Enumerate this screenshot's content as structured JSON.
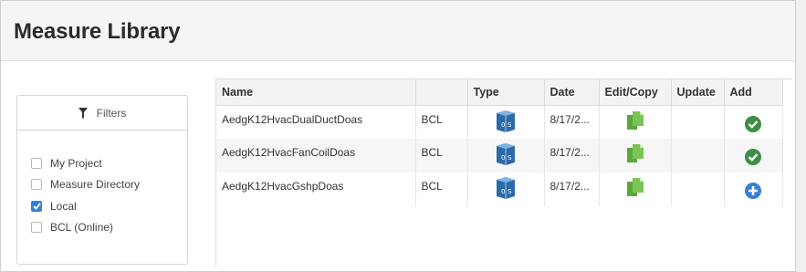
{
  "header": {
    "title": "Measure Library"
  },
  "filters": {
    "title": "Filters",
    "items": [
      {
        "label": "My Project",
        "checked": false
      },
      {
        "label": "Measure Directory",
        "checked": false
      },
      {
        "label": "Local",
        "checked": true
      },
      {
        "label": "BCL (Online)",
        "checked": false
      }
    ]
  },
  "table": {
    "columns": [
      "Name",
      "",
      "Type",
      "Date",
      "Edit/Copy",
      "Update",
      "Add"
    ],
    "rows": [
      {
        "name": "AedgK12HvacDualDuctDoas",
        "source": "BCL",
        "type_icon": "openstudio-icon",
        "date": "8/17/2...",
        "edit_icon": "copy-icon",
        "add_icon": "checkmark-icon",
        "add_status": "added"
      },
      {
        "name": "AedgK12HvacFanCoilDoas",
        "source": "BCL",
        "type_icon": "openstudio-icon",
        "date": "8/17/2...",
        "edit_icon": "copy-icon",
        "add_icon": "checkmark-icon",
        "add_status": "added"
      },
      {
        "name": "AedgK12HvacGshpDoas",
        "source": "BCL",
        "type_icon": "openstudio-icon",
        "date": "8/17/2...",
        "edit_icon": "copy-icon",
        "add_icon": "plus-icon",
        "add_status": "not-added"
      }
    ]
  },
  "colors": {
    "accent_blue": "#3a7fd5",
    "check_green": "#3c8f45",
    "copy_green": "#5aa83c"
  }
}
